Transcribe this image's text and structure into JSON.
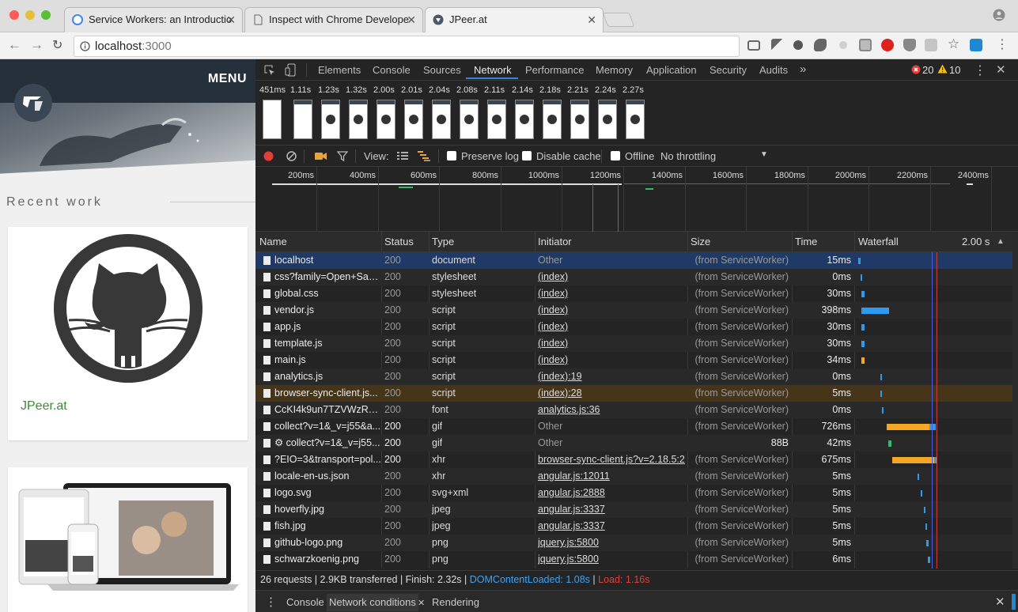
{
  "browser": {
    "tabs": [
      {
        "title": "Service Workers: an Introductio"
      },
      {
        "title": "Inspect with Chrome Develope"
      },
      {
        "title": "JPeer.at"
      }
    ],
    "url_host": "localhost",
    "url_port": ":3000"
  },
  "page": {
    "menu_label": "MENU",
    "section_title": "Recent work",
    "card1_title": "JPeer.at"
  },
  "devtools": {
    "tabs": [
      "Elements",
      "Console",
      "Sources",
      "Network",
      "Performance",
      "Memory",
      "Application",
      "Security",
      "Audits",
      "»"
    ],
    "active_tab": "Network",
    "errors": "20",
    "warnings": "10",
    "filmstrip_times": [
      "451ms",
      "1.11s",
      "1.23s",
      "1.32s",
      "2.00s",
      "2.01s",
      "2.04s",
      "2.08s",
      "2.11s",
      "2.14s",
      "2.18s",
      "2.21s",
      "2.24s",
      "2.27s"
    ],
    "controls": {
      "view_label": "View:",
      "preserve_log": "Preserve log",
      "disable_cache": "Disable cache",
      "offline": "Offline",
      "throttling": "No throttling"
    },
    "timeline_ticks": [
      "200ms",
      "400ms",
      "600ms",
      "800ms",
      "1000ms",
      "1200ms",
      "1400ms",
      "1600ms",
      "1800ms",
      "2000ms",
      "2200ms",
      "2400ms"
    ],
    "columns": {
      "name": "Name",
      "status": "Status",
      "type": "Type",
      "initiator": "Initiator",
      "size": "Size",
      "time": "Time",
      "waterfall": "Waterfall",
      "waterfall_scale": "2.00 s"
    },
    "rows": [
      {
        "name": "localhost",
        "status": "200",
        "type": "document",
        "initiator": "Other",
        "size": "(from ServiceWorker)",
        "time": "15ms"
      },
      {
        "name": "css?family=Open+San...",
        "status": "200",
        "type": "stylesheet",
        "initiator": "(index)",
        "size": "(from ServiceWorker)",
        "time": "0ms"
      },
      {
        "name": "global.css",
        "status": "200",
        "type": "stylesheet",
        "initiator": "(index)",
        "size": "(from ServiceWorker)",
        "time": "30ms"
      },
      {
        "name": "vendor.js",
        "status": "200",
        "type": "script",
        "initiator": "(index)",
        "size": "(from ServiceWorker)",
        "time": "398ms"
      },
      {
        "name": "app.js",
        "status": "200",
        "type": "script",
        "initiator": "(index)",
        "size": "(from ServiceWorker)",
        "time": "30ms"
      },
      {
        "name": "template.js",
        "status": "200",
        "type": "script",
        "initiator": "(index)",
        "size": "(from ServiceWorker)",
        "time": "30ms"
      },
      {
        "name": "main.js",
        "status": "200",
        "type": "script",
        "initiator": "(index)",
        "size": "(from ServiceWorker)",
        "time": "34ms"
      },
      {
        "name": "analytics.js",
        "status": "200",
        "type": "script",
        "initiator": "(index):19",
        "size": "(from ServiceWorker)",
        "time": "0ms"
      },
      {
        "name": "browser-sync-client.js...",
        "status": "200",
        "type": "script",
        "initiator": "(index):28",
        "size": "(from ServiceWorker)",
        "time": "5ms"
      },
      {
        "name": "CcKI4k9un7TZVWzRV...",
        "status": "200",
        "type": "font",
        "initiator": "analytics.js:36",
        "size": "(from ServiceWorker)",
        "time": "0ms"
      },
      {
        "name": "collect?v=1&_v=j55&a...",
        "status": "200",
        "type": "gif",
        "initiator": "Other",
        "size": "(from ServiceWorker)",
        "time": "726ms"
      },
      {
        "name": "⚙ collect?v=1&_v=j55...",
        "status": "200",
        "type": "gif",
        "initiator": "Other",
        "size": "88B",
        "time": "42ms"
      },
      {
        "name": "?EIO=3&transport=pol...",
        "status": "200",
        "type": "xhr",
        "initiator": "browser-sync-client.js?v=2.18.5:2",
        "size": "(from ServiceWorker)",
        "time": "675ms"
      },
      {
        "name": "locale-en-us.json",
        "status": "200",
        "type": "xhr",
        "initiator": "angular.js:12011",
        "size": "(from ServiceWorker)",
        "time": "5ms"
      },
      {
        "name": "logo.svg",
        "status": "200",
        "type": "svg+xml",
        "initiator": "angular.js:2888",
        "size": "(from ServiceWorker)",
        "time": "5ms"
      },
      {
        "name": "hoverfly.jpg",
        "status": "200",
        "type": "jpeg",
        "initiator": "angular.js:3337",
        "size": "(from ServiceWorker)",
        "time": "5ms"
      },
      {
        "name": "fish.jpg",
        "status": "200",
        "type": "jpeg",
        "initiator": "angular.js:3337",
        "size": "(from ServiceWorker)",
        "time": "5ms"
      },
      {
        "name": "github-logo.png",
        "status": "200",
        "type": "png",
        "initiator": "jquery.js:5800",
        "size": "(from ServiceWorker)",
        "time": "5ms"
      },
      {
        "name": "schwarzkoenig.png",
        "status": "200",
        "type": "png",
        "initiator": "jquery.js:5800",
        "size": "(from ServiceWorker)",
        "time": "6ms"
      }
    ],
    "status_bar": {
      "summary": "26 requests | 2.9KB transferred | Finish: 2.32s |",
      "dcl": "DOMContentLoaded: 1.08s",
      "sep": "|",
      "load": "Load: 1.16s"
    },
    "drawer_tabs": [
      "Console",
      "Network conditions",
      "Rendering"
    ]
  },
  "colors": {
    "accent": "#3d7ddb",
    "dcl_line": "#4f5ed6",
    "load_line": "#c9413d",
    "wf_wait": "#f5a623",
    "wf_receive": "#2f9bf0",
    "card_title": "#3d8b37"
  }
}
